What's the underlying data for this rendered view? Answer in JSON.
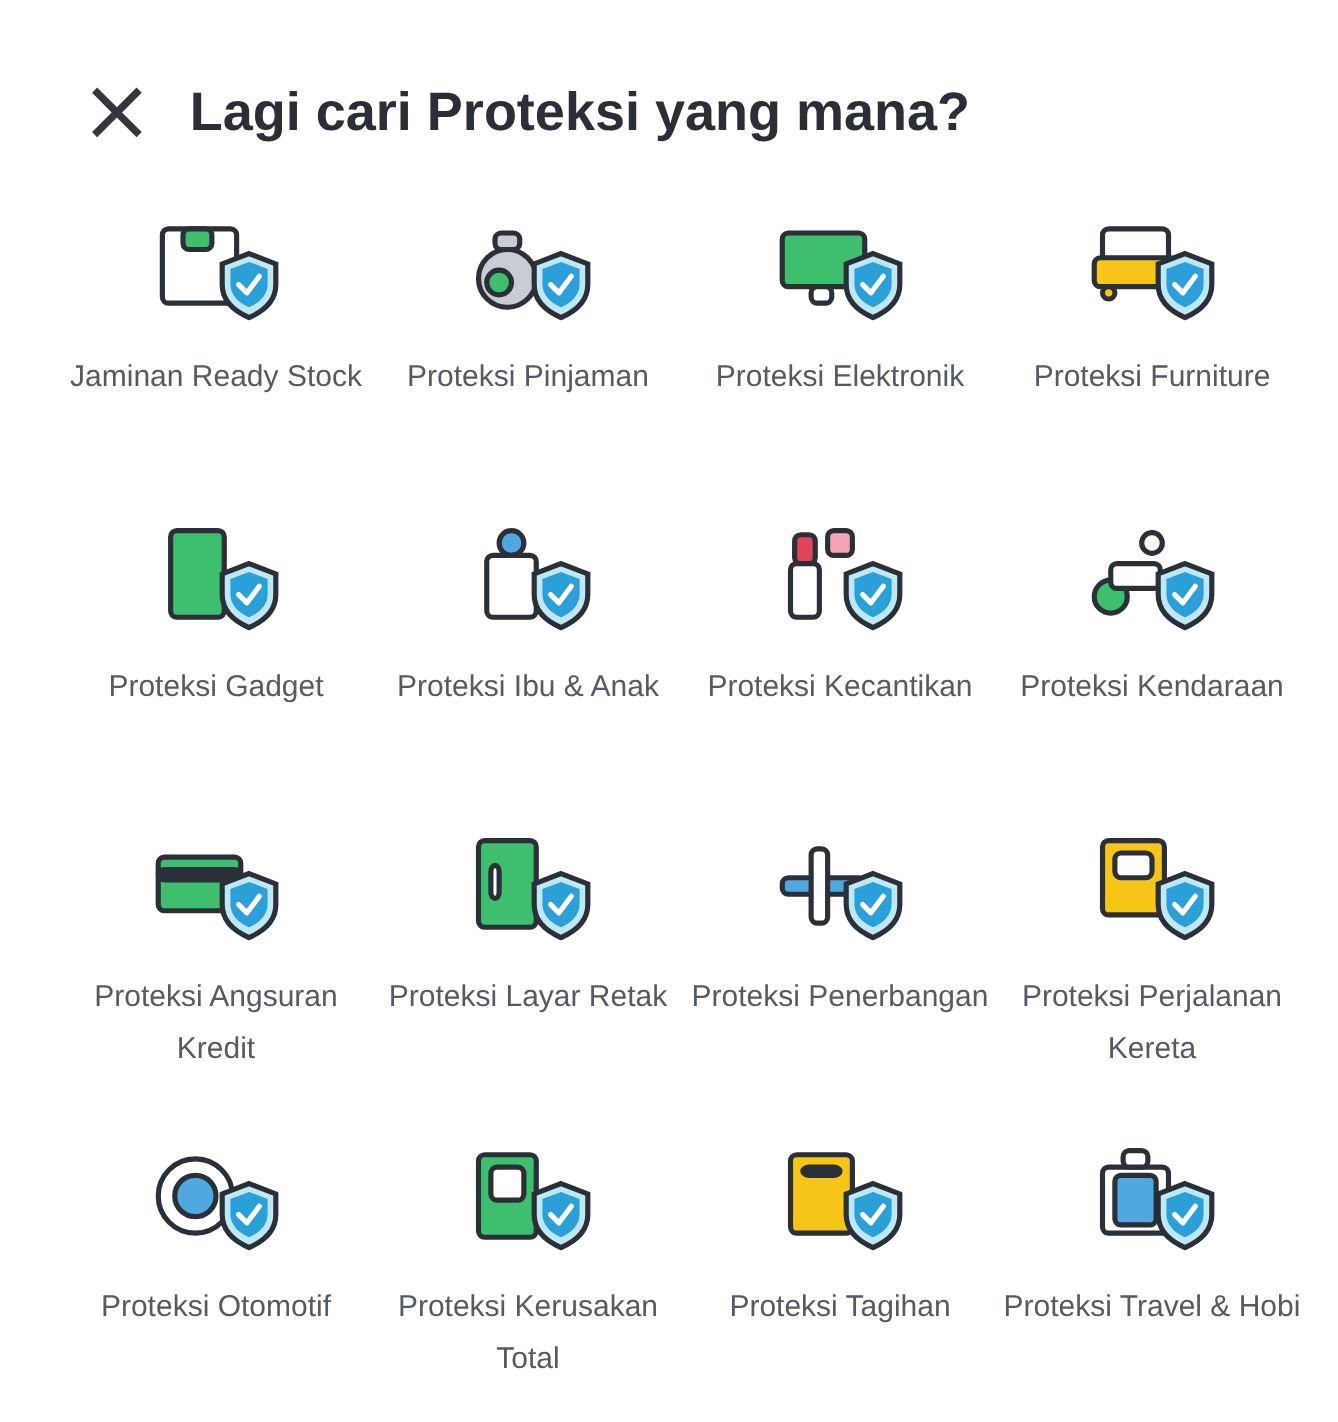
{
  "header": {
    "close_icon": "×",
    "title": "Lagi cari Proteksi yang mana?"
  },
  "products": [
    {
      "label": "Jaminan Ready Stock",
      "kind": "box"
    },
    {
      "label": "Proteksi Pinjaman",
      "kind": "bag"
    },
    {
      "label": "Proteksi Elektronik",
      "kind": "monitor"
    },
    {
      "label": "Proteksi Furniture",
      "kind": "sofa"
    },
    {
      "label": "Proteksi Gadget",
      "kind": "phone"
    },
    {
      "label": "Proteksi Ibu & Anak",
      "kind": "bottle"
    },
    {
      "label": "Proteksi Kecantikan",
      "kind": "lipstick"
    },
    {
      "label": "Proteksi Kendaraan",
      "kind": "scooter"
    },
    {
      "label": "Proteksi Angsuran Kredit",
      "kind": "card"
    },
    {
      "label": "Proteksi Layar Retak",
      "kind": "cracked"
    },
    {
      "label": "Proteksi Penerbangan",
      "kind": "plane"
    },
    {
      "label": "Proteksi Perjalanan Kereta",
      "kind": "train"
    },
    {
      "label": "Proteksi Otomotif",
      "kind": "wheel"
    },
    {
      "label": "Proteksi Kerusakan Total",
      "kind": "broken"
    },
    {
      "label": "Proteksi Tagihan",
      "kind": "bill"
    },
    {
      "label": "Proteksi Travel & Hobi",
      "kind": "luggage"
    }
  ]
}
